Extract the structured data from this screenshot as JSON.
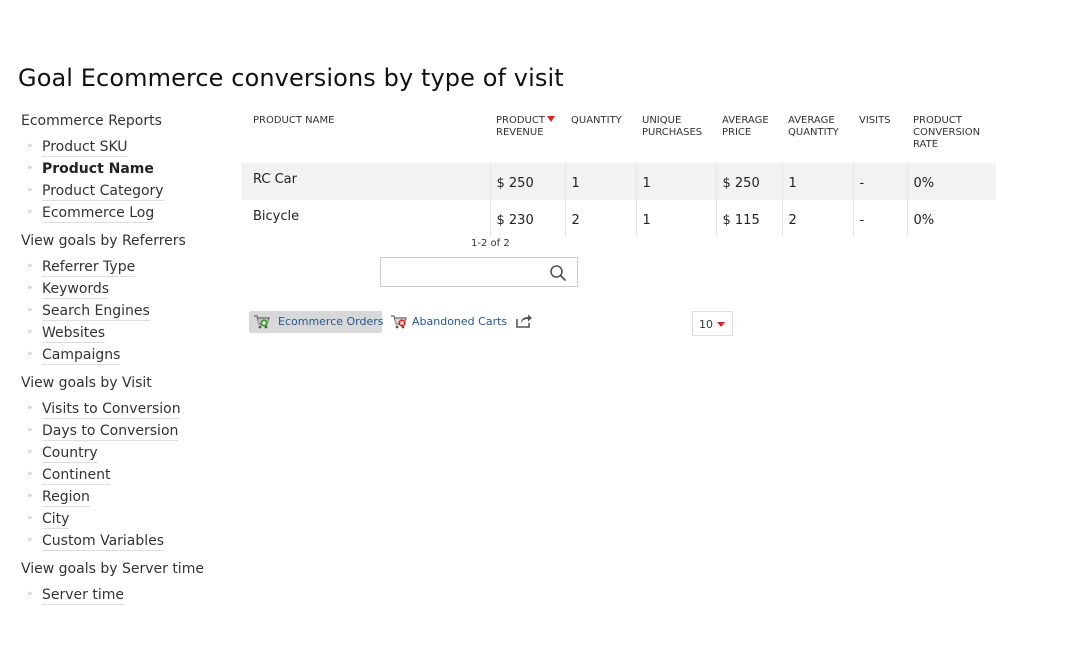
{
  "page": {
    "title": "Goal Ecommerce conversions by type of visit"
  },
  "sidebar": {
    "groups": [
      {
        "title": "Ecommerce Reports",
        "items": [
          {
            "label": "Product SKU"
          },
          {
            "label": "Product Name",
            "active": true
          },
          {
            "label": "Product Category"
          },
          {
            "label": "Ecommerce Log"
          }
        ]
      },
      {
        "title": "View goals by Referrers",
        "items": [
          {
            "label": "Referrer Type"
          },
          {
            "label": "Keywords"
          },
          {
            "label": "Search Engines"
          },
          {
            "label": "Websites"
          },
          {
            "label": "Campaigns"
          }
        ]
      },
      {
        "title": "View goals by Visit",
        "items": [
          {
            "label": "Visits to Conversion"
          },
          {
            "label": "Days to Conversion"
          },
          {
            "label": "Country"
          },
          {
            "label": "Continent"
          },
          {
            "label": "Region"
          },
          {
            "label": "City"
          },
          {
            "label": "Custom Variables"
          }
        ]
      },
      {
        "title": "View goals by Server time",
        "items": [
          {
            "label": "Server time"
          }
        ]
      }
    ],
    "bullet": "»"
  },
  "table": {
    "columns": [
      {
        "label": "PRODUCT NAME"
      },
      {
        "label": "PRODUCT REVENUE",
        "sorted": true
      },
      {
        "label": "QUANTITY"
      },
      {
        "label": "UNIQUE PURCHASES"
      },
      {
        "label": "AVERAGE PRICE"
      },
      {
        "label": "AVERAGE QUANTITY"
      },
      {
        "label": "VISITS"
      },
      {
        "label": "PRODUCT CONVERSION RATE"
      }
    ],
    "rows": [
      {
        "cells": [
          "RC Car",
          "$ 250",
          "1",
          "1",
          "$ 250",
          "1",
          "-",
          "0%"
        ]
      },
      {
        "cells": [
          "Bicycle",
          "$ 230",
          "2",
          "1",
          "$ 115",
          "2",
          "-",
          "0%"
        ]
      }
    ],
    "sort_color": "#d4291f"
  },
  "pagination": {
    "text": "1-2 of 2"
  },
  "search": {
    "value": "",
    "placeholder": "",
    "icon": "search-icon"
  },
  "footer": {
    "ecommerce_orders_label": "Ecommerce Orders",
    "ecommerce_orders_icon": "cart-add-icon",
    "abandoned_carts_label": "Abandoned Carts",
    "abandoned_carts_icon": "cart-remove-icon",
    "export_icon": "export-icon",
    "limit_value": "10"
  }
}
